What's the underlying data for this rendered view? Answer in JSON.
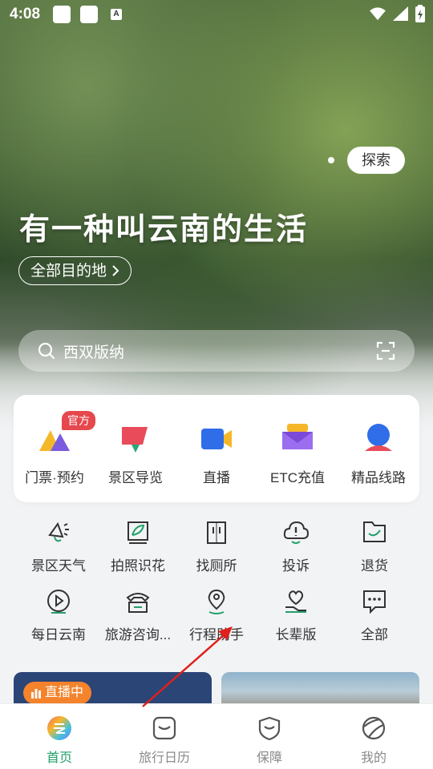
{
  "status": {
    "time": "4:08",
    "mini_icon_text": "A"
  },
  "hero": {
    "explore_label": "探索",
    "slogan": "有一种叫云南的生活",
    "destinations_label": "全部目的地",
    "search_placeholder": "西双版纳"
  },
  "services": [
    {
      "label": "门票·预约",
      "icon": "ticket-icon",
      "badge": "官方"
    },
    {
      "label": "景区导览",
      "icon": "guide-map-icon"
    },
    {
      "label": "直播",
      "icon": "live-camera-icon"
    },
    {
      "label": "ETC充值",
      "icon": "etc-card-icon"
    },
    {
      "label": "精品线路",
      "icon": "route-pin-icon"
    }
  ],
  "tools": [
    {
      "label": "景区天气",
      "icon": "weather-icon"
    },
    {
      "label": "拍照识花",
      "icon": "flower-recognition-icon"
    },
    {
      "label": "找厕所",
      "icon": "toilet-icon"
    },
    {
      "label": "投诉",
      "icon": "complaint-icon"
    },
    {
      "label": "退货",
      "icon": "return-goods-icon"
    },
    {
      "label": "每日云南",
      "icon": "daily-video-icon"
    },
    {
      "label": "旅游咨询...",
      "icon": "phone-consult-icon"
    },
    {
      "label": "行程助手",
      "icon": "itinerary-icon"
    },
    {
      "label": "长辈版",
      "icon": "elder-mode-icon"
    },
    {
      "label": "全部",
      "icon": "more-icon"
    }
  ],
  "live": {
    "badge": "直播中"
  },
  "tabs": [
    {
      "label": "首页",
      "icon": "home-icon",
      "active": true
    },
    {
      "label": "旅行日历",
      "icon": "calendar-icon",
      "active": false
    },
    {
      "label": "保障",
      "icon": "shield-icon",
      "active": false
    },
    {
      "label": "我的",
      "icon": "profile-icon",
      "active": false
    }
  ],
  "colors": {
    "accent": "#22a06b",
    "badge": "#e5484d",
    "live": "#f4832c",
    "annotation_arrow": "#e0201c"
  }
}
